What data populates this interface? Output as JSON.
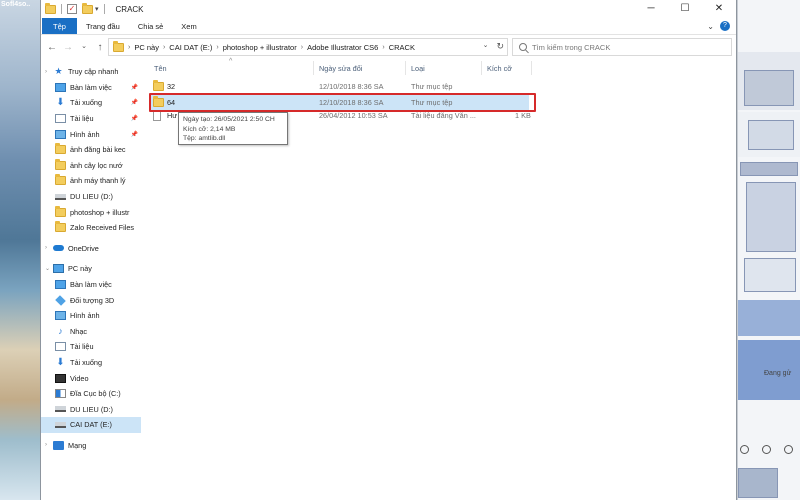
{
  "watermark": "Sofl4so..",
  "window": {
    "title": "CRACK",
    "controls": {
      "minimize": "─",
      "maximize": "☐",
      "close": "✕"
    }
  },
  "ribbon": {
    "tabs": [
      "Tệp",
      "Trang đầu",
      "Chia sẻ",
      "Xem"
    ],
    "expand": "⌄",
    "help": "?"
  },
  "nav_buttons": {
    "back": "←",
    "forward": "→",
    "recent": "⌄",
    "up": "↑"
  },
  "address": {
    "crumbs": [
      "PC này",
      "CAI DAT (E:)",
      "photoshop + illustrator",
      "Adobe Illustrator CS6",
      "CRACK"
    ],
    "dropdown": "⌄",
    "refresh": "↻"
  },
  "search": {
    "placeholder": "Tìm kiếm trong CRACK"
  },
  "nav_pane": {
    "quick_access": "Truy cập nhanh",
    "quick_items": [
      {
        "label": "Bàn làm việc",
        "icon": "desktop-icon"
      },
      {
        "label": "Tải xuống",
        "icon": "download-icon"
      },
      {
        "label": "Tài liệu",
        "icon": "documents-icon"
      },
      {
        "label": "Hình ảnh",
        "icon": "pictures-icon"
      },
      {
        "label": "ảnh đăng bài kec",
        "icon": "folder-icon"
      },
      {
        "label": "ảnh cây lọc nướ",
        "icon": "folder-icon"
      },
      {
        "label": "ảnh máy thanh lý",
        "icon": "folder-icon"
      },
      {
        "label": "DU LIEU (D:)",
        "icon": "drive-icon"
      },
      {
        "label": "photoshop + illustr",
        "icon": "folder-icon"
      },
      {
        "label": "Zalo Received Files",
        "icon": "folder-icon"
      }
    ],
    "onedrive": "OneDrive",
    "this_pc": "PC này",
    "pc_items": [
      {
        "label": "Bàn làm việc",
        "icon": "desktop-icon"
      },
      {
        "label": "Đối tượng 3D",
        "icon": "cube-icon"
      },
      {
        "label": "Hình ảnh",
        "icon": "pictures-icon"
      },
      {
        "label": "Nhạc",
        "icon": "music-icon"
      },
      {
        "label": "Tài liệu",
        "icon": "documents-icon"
      },
      {
        "label": "Tải xuống",
        "icon": "download-icon"
      },
      {
        "label": "Video",
        "icon": "video-icon"
      },
      {
        "label": "Đĩa Cục bộ (C:)",
        "icon": "windows-drive-icon"
      },
      {
        "label": "DU LIEU (D:)",
        "icon": "drive-icon"
      },
      {
        "label": "CAI DAT (E:)",
        "icon": "drive-icon"
      }
    ],
    "network": "Mạng"
  },
  "columns": {
    "name": "Tên",
    "modified": "Ngày sửa đổi",
    "type": "Loại",
    "size": "Kích cỡ"
  },
  "files": [
    {
      "name": "32",
      "modified": "12/10/2018 8:36 SA",
      "type": "Thư mục tệp",
      "size": "",
      "icon": "folder-icon"
    },
    {
      "name": "64",
      "modified": "12/10/2018 8:36 SA",
      "type": "Thư mục tệp",
      "size": "",
      "icon": "folder-icon"
    },
    {
      "name": "Hư",
      "modified": "26/04/2012 10:53 SA",
      "type": "Tài liệu đăng Văn ...",
      "size": "1 KB",
      "icon": "file-icon"
    }
  ],
  "tooltip": {
    "created": "Ngày tạo: 26/05/2021 2:50 CH",
    "size": "Kích cỡ: 2,14 MB",
    "files": "Tệp: amtlib.dll"
  },
  "right_app": {
    "status": "Đang gử"
  },
  "colors": {
    "accent": "#1a6fc4",
    "selection": "#cce4f7",
    "highlight_border": "#d62a2a",
    "folder": "#f3cd5d"
  }
}
